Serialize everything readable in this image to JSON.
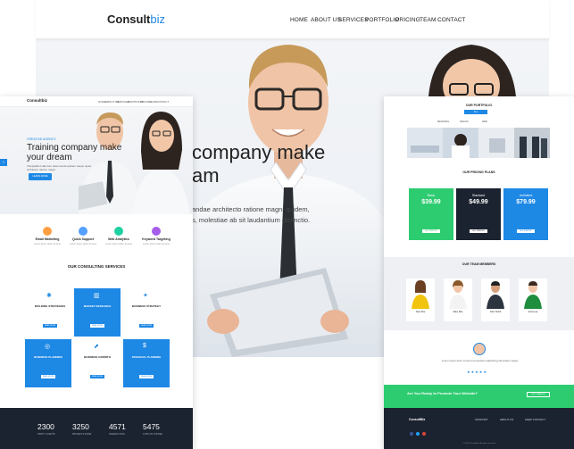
{
  "main": {
    "logo_text": "Consult",
    "logo_accent": "biz",
    "nav": [
      "HOME",
      "ABOUT US",
      "SERVICES",
      "PORTFOLIO",
      "PRICING",
      "TEAM",
      "CONTACT"
    ],
    "hero_title_line1": "company make",
    "hero_title_line2": "am",
    "hero_sub_line1": "andae architecto ratione magni quidem,",
    "hero_sub_line2": "s, molestiae ab sit laudantium distinctio."
  },
  "left_mock": {
    "logo": "Consultbiz",
    "nav": [
      "HOME",
      "ABOUT US",
      "SERVICES",
      "PORTFOLIO",
      "PRICING",
      "TEAM",
      "CONTACT"
    ],
    "small_label": "CREATIVE AGENCY",
    "title_line1": "Training company make",
    "title_line2": "your dream",
    "desc": "Voluptatibus laborum assumenda quidem saepe quasi architecto ratione magni",
    "button": "LEARN MORE",
    "features": [
      {
        "label": "Email Marketing",
        "desc": "Lorem ipsum dolor sit amet"
      },
      {
        "label": "Quick Support",
        "desc": "Lorem ipsum dolor sit amet"
      },
      {
        "label": "Web Analytics",
        "desc": "Lorem ipsum dolor sit amet"
      },
      {
        "label": "Keyword Targeting",
        "desc": "Lorem ipsum dolor sit amet"
      }
    ],
    "services_title": "OUR CONSULTING SERVICES",
    "services": [
      {
        "label": "BUILDING STRATEGIES",
        "btn": "READ MORE"
      },
      {
        "label": "MARKET RESEARCH",
        "btn": "READ MORE"
      },
      {
        "label": "BUSINESS STRATEGY",
        "btn": "READ MORE"
      },
      {
        "label": "BUSINESS PLANNING",
        "btn": "READ MORE"
      },
      {
        "label": "BUSINESS GROWTH",
        "btn": "READ MORE"
      },
      {
        "label": "FINANCIAL PLANNING",
        "btn": "READ MORE"
      }
    ],
    "stats": [
      {
        "value": "2300",
        "label": "HAPPY CLIENTS"
      },
      {
        "value": "3250",
        "label": "PROJECTS DONE"
      },
      {
        "value": "4571",
        "label": "AWARDS WON"
      },
      {
        "value": "5475",
        "label": "CUPS OF COFFEE"
      }
    ]
  },
  "right_mock": {
    "portfolio_title": "OUR PORTFOLIO",
    "portfolio_tabs": [
      "ALL",
      "BRANDING",
      "DESIGN",
      "WEB"
    ],
    "pricing_title": "OUR PRICING PLANS",
    "plans": [
      {
        "name": "Basic",
        "price": "$39.99",
        "color": "#2ecc71",
        "btn": "GET STARTED"
      },
      {
        "name": "Standard",
        "price": "$49.99",
        "color": "#1c2330",
        "btn": "GET STARTED"
      },
      {
        "name": "Unlimited",
        "price": "$79.99",
        "color": "#1e88e5",
        "btn": "GET STARTED"
      }
    ],
    "team_title": "OUR TEAM MEMBERS",
    "team": [
      {
        "name": "Jane Doe",
        "role": "CEO"
      },
      {
        "name": "Mary Roe",
        "role": "Designer"
      },
      {
        "name": "John Smith",
        "role": "Developer"
      },
      {
        "name": "Anna Lee",
        "role": "Manager"
      }
    ],
    "testimonial": "Lorem ipsum dolor sit amet consectetur adipisicing elit quidem saepe",
    "testimonial_stars": "★★★★★",
    "cta_text": "Are You Ready to Promote Your Website?",
    "cta_button": "GET STARTED",
    "footer_brand": "ConsultBiz",
    "footer_col1": "SUPPORT",
    "footer_col2": "ABOUT US",
    "footer_col3": "KEEP CONTACT",
    "copyright": "© 2018 Consultbiz. All rights reserved"
  },
  "colors": {
    "accent": "#1e88e5",
    "green": "#2ecc71",
    "dark": "#1c2330"
  }
}
